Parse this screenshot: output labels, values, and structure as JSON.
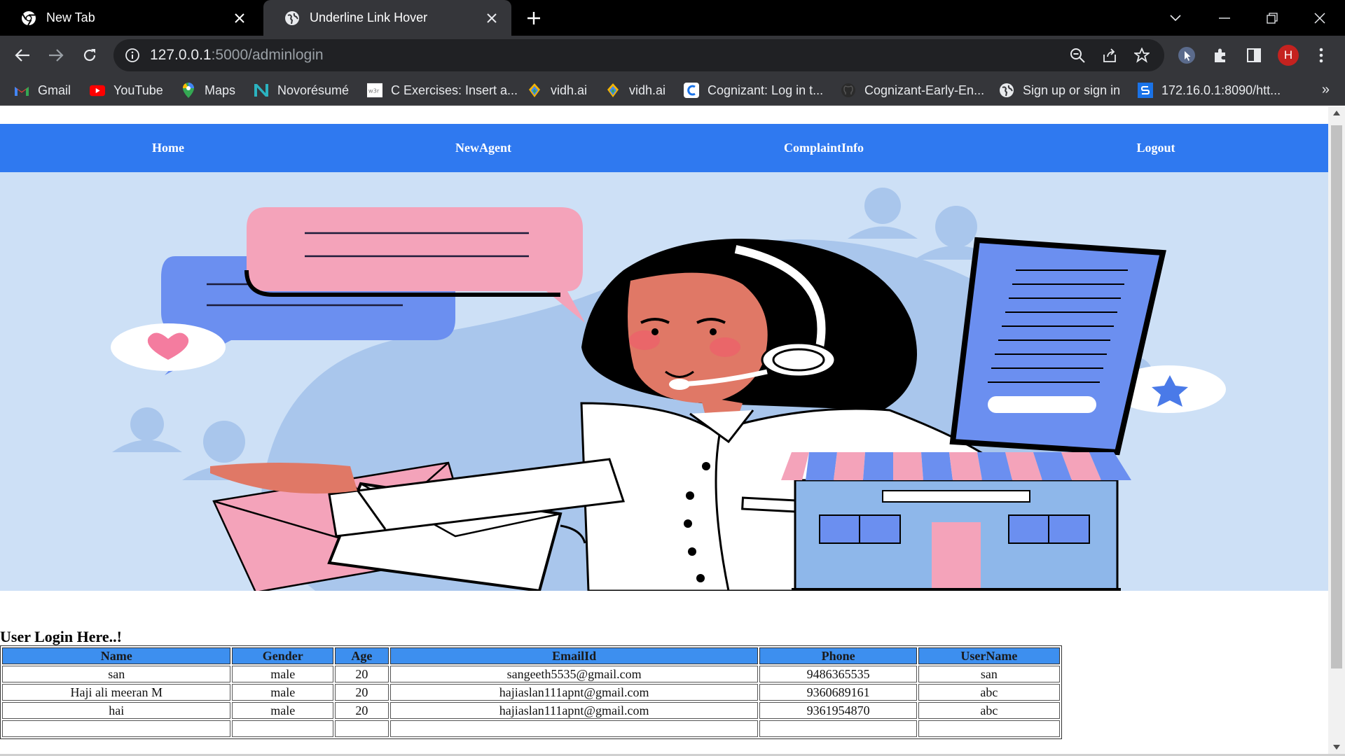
{
  "browser": {
    "tabs": [
      {
        "title": "New Tab",
        "icon": "chrome-icon",
        "active": false
      },
      {
        "title": "Underline Link Hover",
        "icon": "globe-icon",
        "active": true
      }
    ],
    "url": {
      "host": "127.0.0.1",
      "path": ":5000/adminlogin"
    },
    "profile_initial": "H",
    "bookmarks": [
      {
        "label": "Gmail",
        "icon": "gmail-icon"
      },
      {
        "label": "YouTube",
        "icon": "youtube-icon"
      },
      {
        "label": "Maps",
        "icon": "maps-icon"
      },
      {
        "label": "Novorésumé",
        "icon": "novoresume-icon"
      },
      {
        "label": "C Exercises: Insert a...",
        "icon": "w3resource-icon"
      },
      {
        "label": "vidh.ai",
        "icon": "vidhai-icon"
      },
      {
        "label": "vidh.ai",
        "icon": "vidhai-icon"
      },
      {
        "label": "Cognizant: Log in t...",
        "icon": "cognizant-icon"
      },
      {
        "label": "Cognizant-Early-En...",
        "icon": "github-icon"
      },
      {
        "label": "Sign up or sign in",
        "icon": "globe-icon"
      },
      {
        "label": "172.16.0.1:8090/htt...",
        "icon": "sophos-icon"
      }
    ],
    "bookmarks_overflow": "»"
  },
  "page": {
    "nav": [
      "Home",
      "NewAgent",
      "ComplaintInfo",
      "Logout"
    ],
    "section_title": "User Login Here..!",
    "table": {
      "headers": [
        "Name",
        "Gender",
        "Age",
        "EmailId",
        "Phone",
        "UserName"
      ],
      "rows": [
        [
          "san",
          "male",
          "20",
          "sangeeth5535@gmail.com",
          "9486365535",
          "san"
        ],
        [
          "Haji ali meeran M",
          "male",
          "20",
          "hajiaslan111apnt@gmail.com",
          "9360689161",
          "abc"
        ],
        [
          "hai",
          "male",
          "20",
          "hajiaslan111apnt@gmail.com",
          "9361954870",
          "abc"
        ],
        [
          "",
          "",
          "",
          "",
          "",
          ""
        ]
      ]
    }
  },
  "colors": {
    "nav_bar": "#2f79f0",
    "hero_bg": "#cde0f6",
    "table_header": "#3d8fef",
    "chrome_dark": "#35363a",
    "tabstrip": "#000000"
  }
}
